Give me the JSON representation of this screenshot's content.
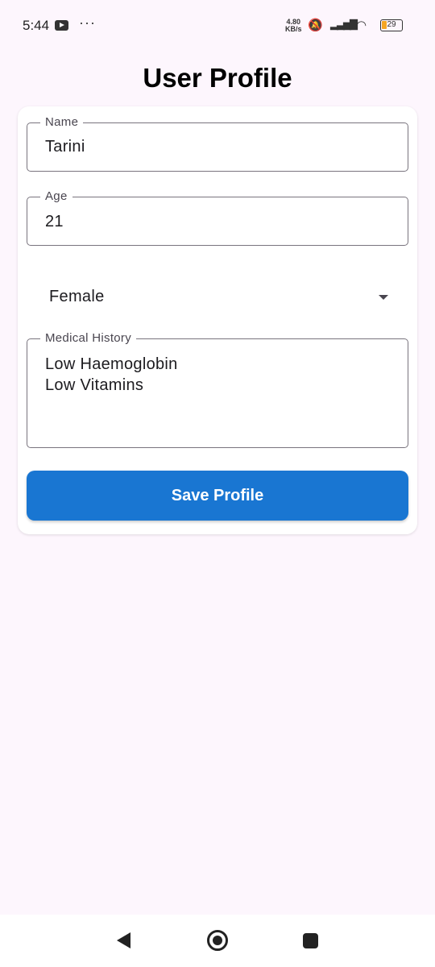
{
  "status_bar": {
    "time": "5:44",
    "more": "···",
    "net_speed_value": "4.80",
    "net_speed_unit": "KB/s",
    "battery": "29",
    "battery_color": "#f5a623"
  },
  "page": {
    "title": "User Profile"
  },
  "form": {
    "name": {
      "label": "Name",
      "value": "Tarini"
    },
    "age": {
      "label": "Age",
      "value": "21"
    },
    "gender": {
      "value": "Female"
    },
    "medical_history": {
      "label": "Medical History",
      "lines": [
        "Low Haemoglobin",
        "Low Vitamins"
      ]
    },
    "save_label": "Save Profile"
  },
  "colors": {
    "accent": "#1976d2",
    "background": "#fdf6fd"
  }
}
